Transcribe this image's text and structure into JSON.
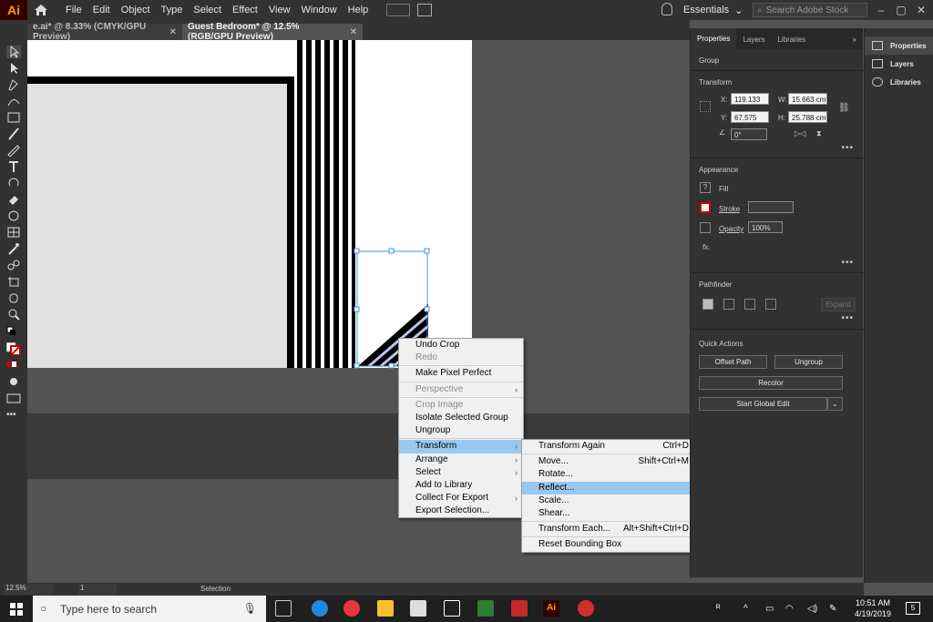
{
  "app": {
    "logo": "Ai"
  },
  "menu": [
    "File",
    "Edit",
    "Object",
    "Type",
    "Select",
    "Effect",
    "View",
    "Window",
    "Help"
  ],
  "workspace": {
    "label": "Essentials",
    "chevron": "⌄"
  },
  "stock_search": {
    "placeholder": "Search Adobe Stock"
  },
  "window_controls": [
    "–",
    "▢",
    "✕"
  ],
  "tabs": [
    {
      "label": "e.ai* @ 8.33% (CMYK/GPU Preview)",
      "close": "✕"
    },
    {
      "label": "Guest Bedroom* @ 12.5% (RGB/GPU Preview)",
      "close": "✕"
    }
  ],
  "context_menu": {
    "items": [
      {
        "label": "Undo Crop",
        "enabled": true
      },
      {
        "label": "Redo",
        "enabled": false
      },
      {
        "separator": true
      },
      {
        "label": "Make Pixel Perfect",
        "enabled": true
      },
      {
        "separator": true
      },
      {
        "label": "Perspective",
        "enabled": false,
        "submenu": true
      },
      {
        "separator": true
      },
      {
        "label": "Crop Image",
        "enabled": false
      },
      {
        "label": "Isolate Selected Group",
        "enabled": true
      },
      {
        "label": "Ungroup",
        "enabled": true
      },
      {
        "separator": true
      },
      {
        "label": "Transform",
        "enabled": true,
        "submenu": true,
        "highlighted": true
      },
      {
        "label": "Arrange",
        "enabled": true,
        "submenu": true
      },
      {
        "label": "Select",
        "enabled": true,
        "submenu": true
      },
      {
        "label": "Add to Library",
        "enabled": true
      },
      {
        "label": "Collect For Export",
        "enabled": true,
        "submenu": true
      },
      {
        "label": "Export Selection...",
        "enabled": true
      }
    ]
  },
  "transform_submenu": {
    "items": [
      {
        "label": "Transform Again",
        "shortcut": "Ctrl+D"
      },
      {
        "separator": true
      },
      {
        "label": "Move...",
        "shortcut": "Shift+Ctrl+M"
      },
      {
        "label": "Rotate...",
        "shortcut": ""
      },
      {
        "label": "Reflect...",
        "shortcut": "",
        "highlighted": true
      },
      {
        "label": "Scale...",
        "shortcut": ""
      },
      {
        "label": "Shear...",
        "shortcut": ""
      },
      {
        "separator": true
      },
      {
        "label": "Transform Each...",
        "shortcut": "Alt+Shift+Ctrl+D"
      },
      {
        "separator": true
      },
      {
        "label": "Reset Bounding Box",
        "shortcut": ""
      }
    ]
  },
  "panel": {
    "tabs": [
      "Properties",
      "Layers",
      "Libraries"
    ],
    "collapse": "»",
    "selection_type": "Group",
    "transform": {
      "title": "Transform",
      "x_label": "X:",
      "x": "119.133 cm",
      "y_label": "Y:",
      "y": "67.575 cm",
      "w_label": "W:",
      "w": "15.663 cm",
      "h_label": "H:",
      "h": "25.788 cm",
      "angle": "0°"
    },
    "appearance": {
      "title": "Appearance",
      "fill_label": "Fill",
      "stroke_label": "Stroke",
      "opacity_label": "Opacity",
      "opacity": "100%",
      "fx_label": "fx."
    },
    "pathfinder": {
      "title": "Pathfinder",
      "expand_label": "Expand"
    },
    "quick_actions": {
      "title": "Quick Actions",
      "offset_path": "Offset Path",
      "ungroup": "Ungroup",
      "recolor": "Recolor",
      "start_global_edit": "Start Global Edit"
    },
    "more": "•••"
  },
  "dock": [
    "Properties",
    "Layers",
    "Libraries"
  ],
  "status": {
    "zoom": "12.5%",
    "artboard": "1",
    "tool": "Selection"
  },
  "taskbar": {
    "search_placeholder": "Type here to search",
    "time": "10:51 AM",
    "date": "4/19/2019",
    "notifications": "5"
  },
  "colors": {
    "accent": "#99c9ef",
    "ai_orange": "#ff9a00",
    "selection_blue": "#4a90e2"
  }
}
